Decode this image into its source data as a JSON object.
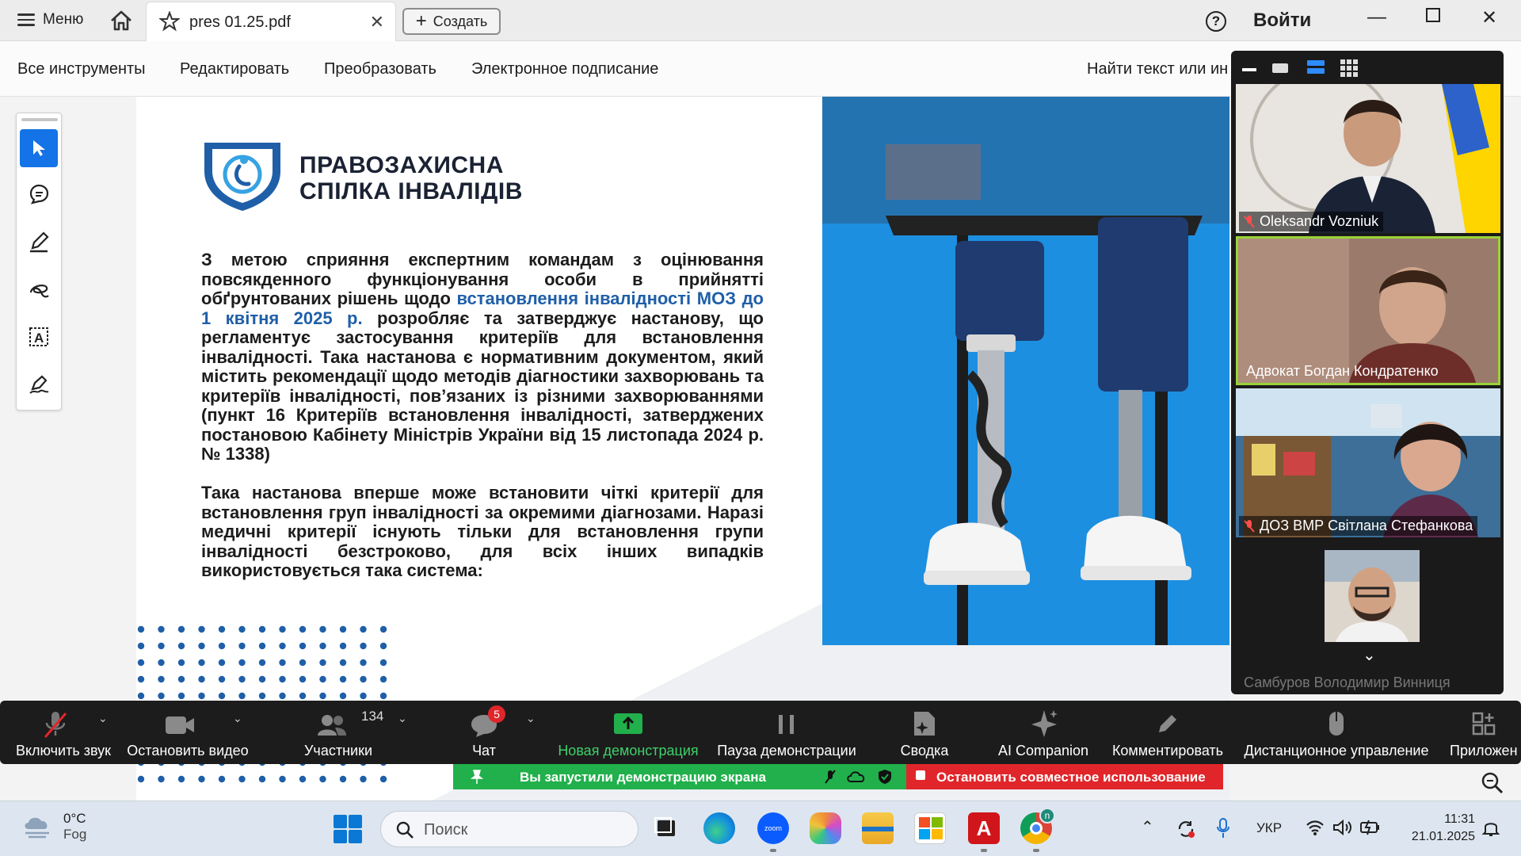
{
  "titlebar": {
    "menu_label": "Меню",
    "tab_name": "pres 01.25.pdf",
    "create_label": "Создать",
    "signin_label": "Войти"
  },
  "tools": {
    "all_tools": "Все инструменты",
    "edit": "Редактировать",
    "convert": "Преобразовать",
    "esign": "Электронное подписание",
    "find": "Найти текст или ин"
  },
  "page": {
    "org_line1": "ПРАВОЗАХИСНА",
    "org_line2": "СПІЛКА ІНВАЛІДІВ",
    "p1_start": "З метою сприяння експертним командам з оцінювання повсякденного функціонування особи в прийнятті обґрунтованих рішень щодо ",
    "p1_highlight": "встановлення інвалідності МОЗ до 1 квітня 2025 р.",
    "p1_end": " розробляє та затверджує настанову, що регламентує застосування критеріїв для встановлення інвалідності. Така настанова є нормативним документом, який містить рекомендації щодо методів діагностики захворювань та критеріїв інвалідності, пов’язаних із різними захворюваннями (пункт 16 Критеріїв встановлення інвалідності, затверджених постановою Кабінету Міністрів України від 15 листопада 2024 р. № 1338)",
    "p2": "Така настанова вперше може встановити чіткі критерії для встановлення груп інвалідності за окремими діагнозами. Наразі медичні критерії існують тільки для встановлення групи інвалідності безстроково, для всіх інших випадків використовується така система:"
  },
  "participants": [
    {
      "name": "Oleksandr Vozniuk"
    },
    {
      "name": "Адвокат Богдан Кондратенко"
    },
    {
      "name": "ДОЗ ВМР Світлана Стефанкова"
    },
    {
      "name": "Самбуров Володимир Винниця"
    }
  ],
  "zoom_bar": {
    "unmute": "Включить звук",
    "stop_video": "Остановить видео",
    "participants": "Участники",
    "participants_count": "134",
    "chat": "Чат",
    "chat_badge": "5",
    "new_share": "Новая демонстрация",
    "pause_share": "Пауза демонстрации",
    "summary": "Сводка",
    "ai_companion": "AI Companion",
    "annotate": "Комментировать",
    "remote_control": "Дистанционное управление",
    "apps": "Приложен"
  },
  "banner": {
    "sharing": "Вы запустили демонстрацию экрана",
    "stop": "Остановить совместное использование"
  },
  "taskbar": {
    "temp": "0°C",
    "weather": "Fog",
    "search": "Поиск",
    "lang": "УКР",
    "time": "11:31",
    "date": "21.01.2025"
  },
  "colors": {
    "accent": "#1473e6",
    "photo_blue": "#1d8fe0",
    "share_green": "#21b04b",
    "stop_red": "#e0262a",
    "highlight_text": "#1f5fa8"
  }
}
